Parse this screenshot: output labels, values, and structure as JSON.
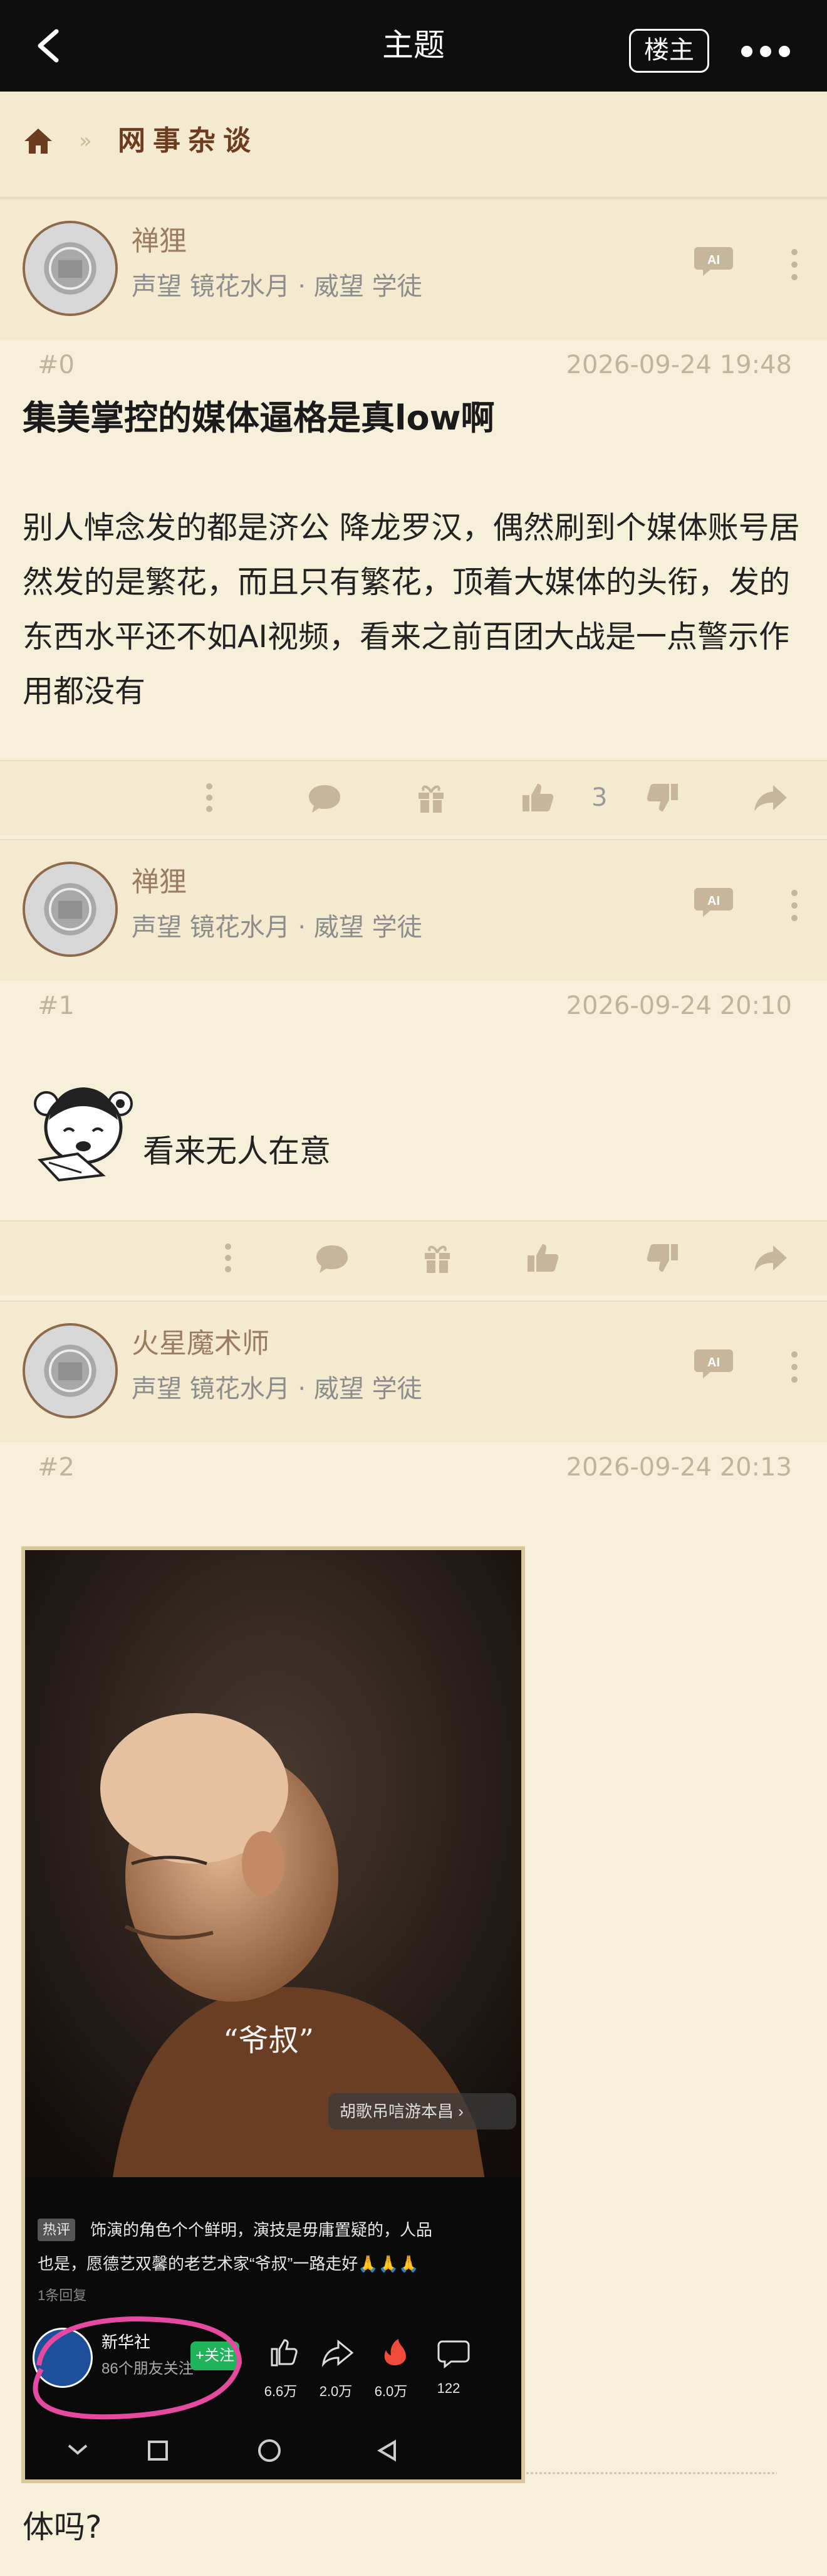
{
  "topbar": {
    "title": "主题",
    "owner_label": "楼主",
    "back_icon": "chevron-left-icon",
    "more_icon": "more-horizontal-icon"
  },
  "breadcrumb": {
    "home_icon": "home-icon",
    "separator": "»",
    "forum": "网事杂谈"
  },
  "posts": [
    {
      "author": "禅狸",
      "rank": "声望 镜花水月 · 威望 学徒",
      "floor": "#0",
      "time": "2026-09-24 19:48",
      "title": "集美掌控的媒体逼格是真low啊",
      "body": "别人悼念发的都是济公 降龙罗汉，偶然刷到个媒体账号居然发的是繁花，而且只有繁花，顶着大媒体的头衔，发的东西水平还不如AI视频，看来之前百团大战是一点警示作用都没有",
      "likes": "3"
    },
    {
      "author": "禅狸",
      "rank": "声望 镜花水月 · 威望 学徒",
      "floor": "#1",
      "time": "2026-09-24 20:10",
      "body": "看来无人在意"
    },
    {
      "author": "火星魔术师",
      "rank": "声望 镜花水月 · 威望 学徒",
      "floor": "#2",
      "time": "2026-09-24 20:13",
      "body_after_image": "体吗?"
    }
  ],
  "embedded_image": {
    "caption": "“爷叔”",
    "tag_button": "胡歌吊唁游本昌 ›",
    "comment_badge": "热评",
    "comment_line1": "饰演的角色个个鲜明，演技是毋庸置疑的，人品",
    "comment_line2": "也是，愿德艺双馨的老艺术家“爷叔”一路走好🙏🙏🙏",
    "reply_count": "1条回复",
    "account_name": "新华社",
    "followers": "86个朋友关注",
    "follow_button": "+关注",
    "stats": [
      "6.6万",
      "2.0万",
      "6.0万",
      "122"
    ]
  },
  "colors": {
    "topbar_bg": "#0e0e0e",
    "page_bg": "#f6efd9",
    "header_bg": "#f3ead0",
    "accent_brown": "#6b3c1e",
    "icon_tan": "#c7b79a"
  }
}
